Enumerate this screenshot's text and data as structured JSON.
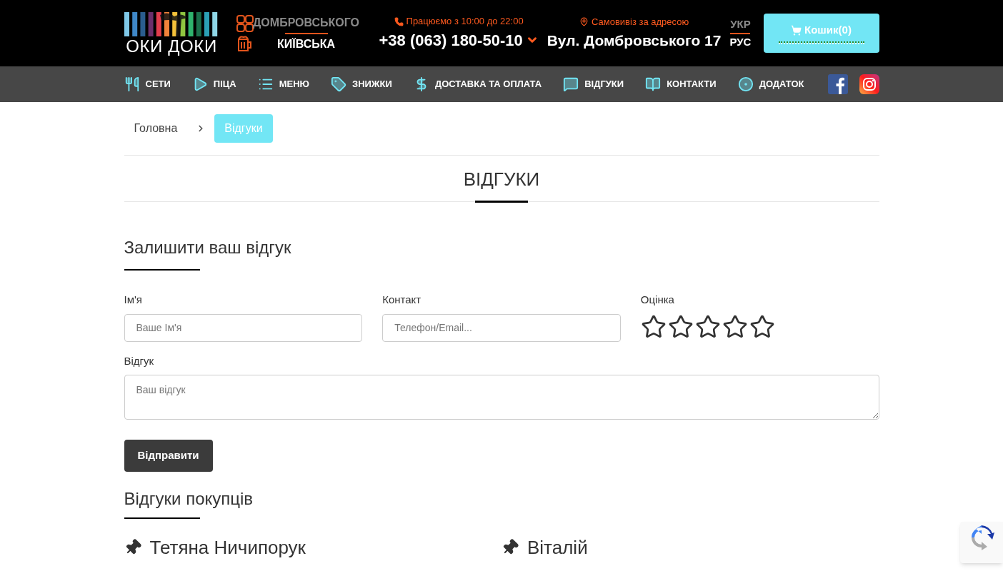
{
  "header": {
    "logo_text": "ОКИ ДОКИ",
    "locations": [
      {
        "label": "ДОМБРОВСЬКОГО",
        "selected": true
      },
      {
        "label": "КИЇВСЬКА",
        "selected": false
      }
    ],
    "hours": "Працюємо з 10:00 до 22:00",
    "phone": "+38 (063) 180-50-10",
    "pickup_label": "Самовивіз за адресою",
    "address": "Вул. Домбровського 17",
    "languages": [
      {
        "label": "УКР",
        "selected": true
      },
      {
        "label": "РУС",
        "selected": false
      }
    ],
    "cart": "Кошик(0)"
  },
  "nav": [
    {
      "label": "СЕТИ"
    },
    {
      "label": "ПІЦА"
    },
    {
      "label": "МЕНЮ"
    },
    {
      "label": "ЗНИЖКИ"
    },
    {
      "label": "ДОСТАВКА ТА ОПЛАТА"
    },
    {
      "label": "ВІДГУКИ"
    },
    {
      "label": "КОНТАКТИ"
    },
    {
      "label": "ДОДАТОК"
    }
  ],
  "breadcrumb": [
    {
      "label": "Головна",
      "selected": false
    },
    {
      "label": "Відгуки",
      "selected": true
    }
  ],
  "page_title": "ВІДГУКИ",
  "form": {
    "title": "Залишити ваш відгук",
    "name": {
      "label": "Ім'я",
      "placeholder": "Ваше Ім'я"
    },
    "contact": {
      "label": "Контакт",
      "placeholder": "Телефон/Email..."
    },
    "rating": {
      "label": "Оцінка",
      "stars": 0
    },
    "review": {
      "label": "Відгук",
      "placeholder": "Ваш відгук"
    },
    "submit": "Відправити"
  },
  "reviews": {
    "title": "Відгуки покупців",
    "items": [
      {
        "author": "Тетяна Ничипорук"
      },
      {
        "author": "Віталій"
      }
    ]
  }
}
